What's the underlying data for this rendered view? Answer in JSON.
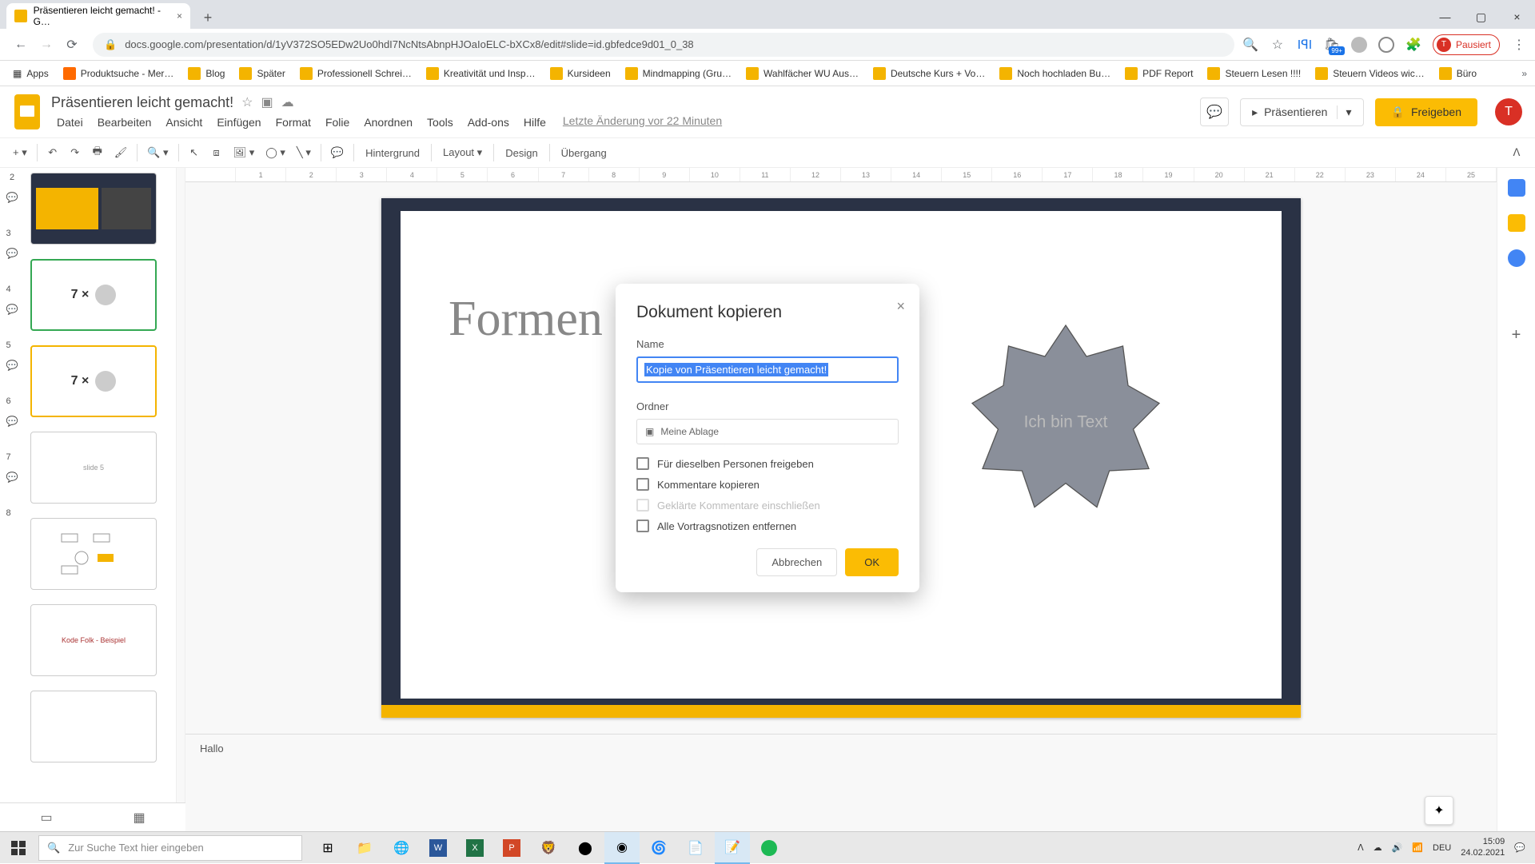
{
  "browser": {
    "tab_title": "Präsentieren leicht gemacht! - G…",
    "url": "docs.google.com/presentation/d/1yV372SO5EDw2Uo0hdI7NcNtsAbnpHJOaIoELC-bXCx8/edit#slide=id.gbfedce9d01_0_38",
    "pause_label": "Pausiert",
    "pause_initial": "T"
  },
  "bookmarks": {
    "apps": "Apps",
    "items": [
      "Produktsuche - Mer…",
      "Blog",
      "Später",
      "Professionell Schrei…",
      "Kreativität und Insp…",
      "Kursideen",
      "Mindmapping  (Gru…",
      "Wahlfächer WU Aus…",
      "Deutsche Kurs + Vo…",
      "Noch hochladen Bu…",
      "PDF Report",
      "Steuern Lesen !!!!",
      "Steuern Videos wic…",
      "Büro"
    ]
  },
  "doc": {
    "title": "Präsentieren leicht gemacht!",
    "meta": "Letzte Änderung vor 22 Minuten"
  },
  "menus": [
    "Datei",
    "Bearbeiten",
    "Ansicht",
    "Einfügen",
    "Format",
    "Folie",
    "Anordnen",
    "Tools",
    "Add-ons",
    "Hilfe"
  ],
  "header_buttons": {
    "present": "Präsentieren",
    "share": "Freigeben"
  },
  "toolbar": {
    "background": "Hintergrund",
    "layout": "Layout",
    "design": "Design",
    "transition": "Übergang"
  },
  "ruler_marks": [
    "",
    "1",
    "2",
    "3",
    "4",
    "5",
    "6",
    "7",
    "8",
    "9",
    "10",
    "11",
    "12",
    "13",
    "14",
    "15",
    "16",
    "17",
    "18",
    "19",
    "20",
    "21",
    "22",
    "23",
    "24",
    "25"
  ],
  "slide": {
    "title": "Formen e",
    "shape_text": "Ich bin Text"
  },
  "thumbs": {
    "n2": "2",
    "n3": "3",
    "n4": "4",
    "n5": "5",
    "n6": "6",
    "n7": "7",
    "n8": "8"
  },
  "notes": "Hallo",
  "dialog": {
    "title": "Dokument kopieren",
    "name_label": "Name",
    "name_value": "Kopie von Präsentieren leicht gemacht!",
    "folder_label": "Ordner",
    "folder_value": "Meine Ablage",
    "chk_share": "Für dieselben Personen freigeben",
    "chk_comments": "Kommentare kopieren",
    "chk_resolved": "Geklärte Kommentare einschließen",
    "chk_notes": "Alle Vortragsnotizen entfernen",
    "cancel": "Abbrechen",
    "ok": "OK"
  },
  "taskbar": {
    "search_placeholder": "Zur Suche Text hier eingeben",
    "lang": "DEU",
    "time": "15:09",
    "date": "24.02.2021"
  }
}
